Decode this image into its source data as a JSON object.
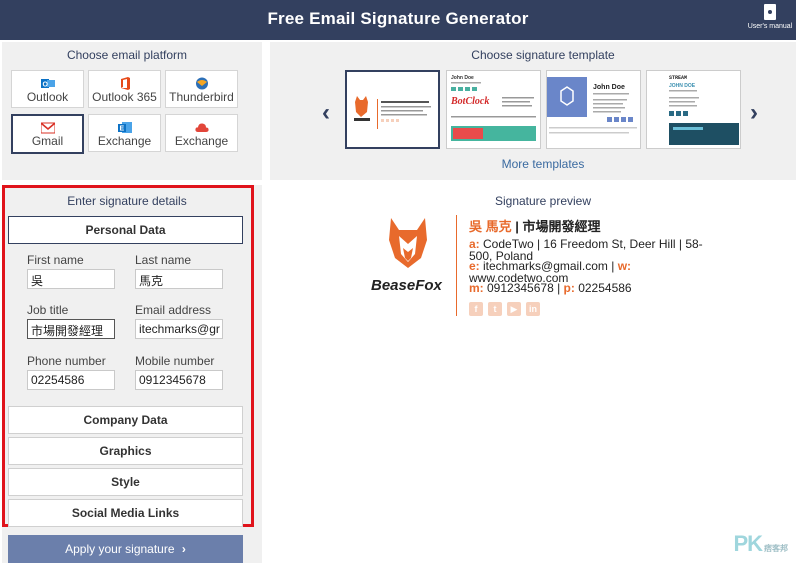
{
  "header": {
    "title": "Free Email Signature Generator",
    "manual_label": "User's manual"
  },
  "platform": {
    "title": "Choose email platform",
    "items": [
      {
        "label": "Outlook",
        "icon": "outlook-icon",
        "color": "#0b71c5"
      },
      {
        "label": "Outlook 365",
        "icon": "office365-icon",
        "color": "#e64a19"
      },
      {
        "label": "Thunderbird",
        "icon": "thunderbird-icon",
        "color": "#2c6fb7"
      },
      {
        "label": "Gmail",
        "icon": "gmail-icon",
        "color": "#d93025",
        "selected": true
      },
      {
        "label": "Exchange",
        "icon": "exchange-icon",
        "color": "#0b71c5"
      },
      {
        "label": "Exchange",
        "icon": "exchange-cloud-icon",
        "color": "#e2463a"
      }
    ]
  },
  "templates": {
    "title": "Choose signature template",
    "more_label": "More templates",
    "thumbs": {
      "t2_name": "John Doe",
      "t2_logo": "BotClock",
      "t3_name": "John Doe",
      "t4_name": "STREAM",
      "t4_person": "JOHN DOE"
    }
  },
  "details": {
    "title": "Enter signature details",
    "sections": {
      "personal": "Personal Data",
      "company": "Company Data",
      "graphics": "Graphics",
      "style": "Style",
      "social": "Social Media Links"
    },
    "fields": {
      "first_name_label": "First name",
      "first_name_value": "吳",
      "last_name_label": "Last name",
      "last_name_value": "馬克",
      "job_title_label": "Job title",
      "job_title_value": "市場開發經理",
      "email_label": "Email address",
      "email_value": "itechmarks@gr",
      "phone_label": "Phone number",
      "phone_value": "02254586",
      "mobile_label": "Mobile number",
      "mobile_value": "0912345678"
    },
    "apply_label": "Apply your signature"
  },
  "preview": {
    "title": "Signature preview",
    "name": "吳 馬克",
    "separator": " | ",
    "job": "市場開發經理",
    "address_key": "a:",
    "address_line1": " CodeTwo | 16 Freedom St, Deer Hill | 58-",
    "address_line2": "500, Poland",
    "email_key": "e:",
    "email": " itechmarks@gmail.com",
    "web_sep": " | ",
    "web_key": "w:",
    "web": "www.codetwo.com",
    "mobile_key": "m:",
    "mobile": " 0912345678",
    "phone_sep": " | ",
    "phone_key": "p:",
    "phone": " 02254586",
    "logo_text": "BeaseFox",
    "accent_color": "#e86a2c"
  },
  "watermark": {
    "text": "PK",
    "sub": "痞客邦"
  }
}
